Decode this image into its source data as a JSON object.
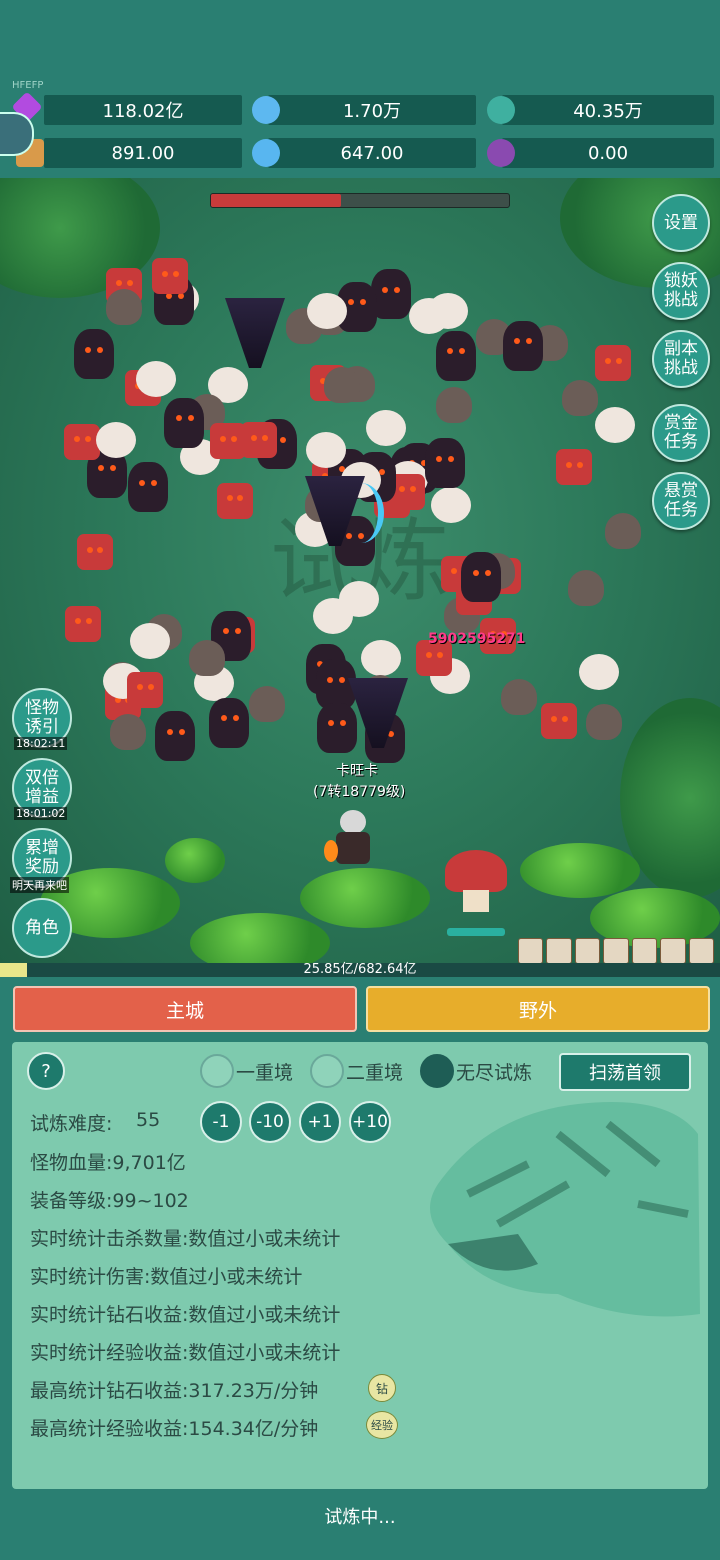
{
  "top": {
    "tag": "HFEFP",
    "resources": [
      {
        "icon": "diamond-icon",
        "value": "118.02亿",
        "color": "#b24be0"
      },
      {
        "icon": "crystal-icon",
        "value": "1.70万",
        "color": "#5db8f0"
      },
      {
        "icon": "globe-icon",
        "value": "40.35万",
        "color": "#3fb0a0"
      },
      {
        "icon": "scroll-icon",
        "value": "891.00",
        "color": "#d99a4a"
      },
      {
        "icon": "ice-icon",
        "value": "647.00",
        "color": "#58b6f0"
      },
      {
        "icon": "potion-icon",
        "value": "0.00",
        "color": "#8a4ab0"
      }
    ]
  },
  "game": {
    "boss_hp_fraction": 0.44,
    "damage_number": "5902595271",
    "player_name": "卡旺卡",
    "player_level": "(7转18779级)",
    "watermark": "试炼"
  },
  "right_buttons": [
    {
      "label": "设置"
    },
    {
      "label": "锁妖\n挑战"
    },
    {
      "label": "副本\n挑战"
    },
    {
      "label": "赏金\n任务"
    },
    {
      "label": "悬赏\n任务"
    }
  ],
  "left_buttons": [
    {
      "label": "怪物\n诱引",
      "time": "18:02:11"
    },
    {
      "label": "双倍\n增益",
      "time": "18:01:02"
    },
    {
      "label": "累增\n奖励",
      "time": "明天再来吧"
    },
    {
      "label": "角色",
      "time": ""
    }
  ],
  "exp": {
    "text": "25.85亿/682.64亿",
    "fraction": 0.038
  },
  "nav": {
    "main_city": "主城",
    "wild": "野外"
  },
  "panel": {
    "help": "?",
    "modes": [
      "一重境",
      "二重境",
      "无尽试炼"
    ],
    "selected_mode": "无尽试炼",
    "sweep": "扫荡首领",
    "difficulty_label": "试炼难度:",
    "difficulty_value": "55",
    "steps": [
      "-1",
      "-10",
      "+1",
      "+10"
    ],
    "lines": [
      "怪物血量:9,701亿",
      "装备等级:99~102",
      "实时统计击杀数量:数值过小或未统计",
      "实时统计伤害:数值过小或未统计",
      "实时统计钻石收益:数值过小或未统计",
      "实时统计经验收益:数值过小或未统计",
      "最高统计钻石收益:317.23万/分钟",
      "最高统计经验收益:154.34亿/分钟"
    ],
    "badges": [
      "钻",
      "经验"
    ],
    "status": "试炼中..."
  }
}
